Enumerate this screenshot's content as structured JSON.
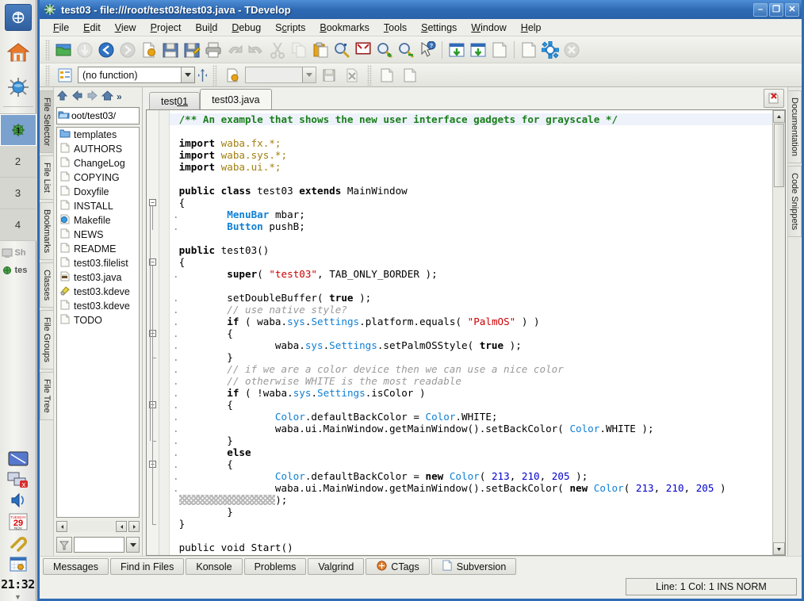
{
  "panel": {
    "launchers": [
      {
        "name": "kmenu-icon",
        "label": "K Menu"
      },
      {
        "name": "home-icon",
        "label": "Home"
      },
      {
        "name": "konqueror-icon",
        "label": "Konqueror"
      }
    ],
    "desktops": [
      "1",
      "2",
      "3",
      "4"
    ],
    "active_desktop": "1",
    "tasks": [
      {
        "label": "Sh",
        "icon": "screen-icon",
        "dim": true
      },
      {
        "label": "tes",
        "icon": "tdevelop-icon",
        "dim": false
      }
    ],
    "tray": [
      {
        "name": "display-icon"
      },
      {
        "name": "network-disconnected-icon"
      },
      {
        "name": "volume-icon"
      },
      {
        "name": "calendar-icon",
        "day": "29",
        "month": "NOV",
        "weekday": "TUESDAY"
      },
      {
        "name": "klipper-icon"
      },
      {
        "name": "korganizer-icon"
      }
    ],
    "clock": "21:32",
    "collapse": "▼"
  },
  "window": {
    "title": "test03 - file:///root/test03/test03.java - TDevelop",
    "app_icon": "tdevelop-icon",
    "buttons": {
      "minimize": "–",
      "maximize": "❐",
      "close": "✕"
    }
  },
  "menubar": {
    "items": [
      {
        "label": "File",
        "accel": "F"
      },
      {
        "label": "Edit",
        "accel": "E"
      },
      {
        "label": "View",
        "accel": "V"
      },
      {
        "label": "Project",
        "accel": "P"
      },
      {
        "label": "Build",
        "accel": "l"
      },
      {
        "label": "Debug",
        "accel": "D"
      },
      {
        "label": "Scripts",
        "accel": "c"
      },
      {
        "label": "Bookmarks",
        "accel": "B"
      },
      {
        "label": "Tools",
        "accel": "T"
      },
      {
        "label": "Settings",
        "accel": "S"
      },
      {
        "label": "Window",
        "accel": "W"
      },
      {
        "label": "Help",
        "accel": "H"
      }
    ]
  },
  "toolbar_main": {
    "buttons": [
      {
        "name": "open-file-icon",
        "enabled": true
      },
      {
        "name": "down-arrow-icon",
        "enabled": false
      },
      {
        "name": "back-arrow-icon",
        "enabled": true
      },
      {
        "name": "forward-arrow-icon",
        "enabled": false
      },
      {
        "name": "new-file-icon",
        "enabled": true
      },
      {
        "name": "save-icon",
        "enabled": true
      },
      {
        "name": "save-as-icon",
        "enabled": true
      },
      {
        "name": "print-icon",
        "enabled": true
      },
      {
        "name": "undo-icon",
        "enabled": false
      },
      {
        "name": "redo-icon",
        "enabled": false
      },
      {
        "name": "cut-icon",
        "enabled": false
      },
      {
        "name": "copy-icon",
        "enabled": false
      },
      {
        "name": "paste-icon",
        "enabled": true
      },
      {
        "name": "find-icon",
        "enabled": true
      },
      {
        "name": "find-in-files-icon",
        "enabled": true
      },
      {
        "name": "zoom-in-icon",
        "enabled": true
      },
      {
        "name": "zoom-out-icon",
        "enabled": true
      },
      {
        "name": "whats-this-icon",
        "enabled": true
      },
      {
        "name": "build-project-icon",
        "enabled": true
      },
      {
        "name": "build-file-icon",
        "enabled": true
      },
      {
        "name": "run-icon",
        "enabled": true
      },
      {
        "name": "execute-icon",
        "enabled": true
      },
      {
        "name": "configure-icon",
        "enabled": true
      },
      {
        "name": "stop-icon",
        "enabled": false
      }
    ]
  },
  "toolbar_browser": {
    "outline_icon": "code-outline-icon",
    "function_combo": {
      "value": "(no function)",
      "placeholder": "(no function)"
    },
    "resize_handle": "horizontal-resize-handle",
    "buttons_left": [
      {
        "name": "new-document-icon"
      }
    ],
    "second_combo": {
      "value": ""
    },
    "buttons_right": [
      {
        "name": "save-small-icon"
      },
      {
        "name": "revert-icon"
      },
      {
        "name": "prev-document-icon"
      },
      {
        "name": "next-document-icon"
      }
    ]
  },
  "left_tabs": {
    "items": [
      {
        "label": "File Selector",
        "selected": true
      },
      {
        "label": "File List",
        "selected": false
      },
      {
        "label": "Bookmarks",
        "selected": false
      },
      {
        "label": "Classes",
        "selected": false
      },
      {
        "label": "File Groups",
        "selected": false
      },
      {
        "label": "File Tree",
        "selected": false
      }
    ]
  },
  "right_tabs": {
    "items": [
      {
        "label": "Documentation",
        "selected": false
      },
      {
        "label": "Code Snippets",
        "selected": false
      }
    ]
  },
  "file_selector": {
    "nav": [
      {
        "name": "up-icon",
        "glyph": "⬆"
      },
      {
        "name": "back-icon",
        "glyph": "⬅"
      },
      {
        "name": "forward-icon",
        "glyph": "➡"
      },
      {
        "name": "home-icon",
        "glyph": "⌂"
      },
      {
        "name": "more-icon",
        "glyph": "»"
      }
    ],
    "path": "oot/test03/",
    "path_icon": "folder-open-icon",
    "files": [
      {
        "name": "templates",
        "icon": "folder-icon"
      },
      {
        "name": "AUTHORS",
        "icon": "file-icon"
      },
      {
        "name": "ChangeLog",
        "icon": "file-icon"
      },
      {
        "name": "COPYING",
        "icon": "file-icon"
      },
      {
        "name": "Doxyfile",
        "icon": "file-icon"
      },
      {
        "name": "INSTALL",
        "icon": "file-icon"
      },
      {
        "name": "Makefile",
        "icon": "makefile-icon"
      },
      {
        "name": "NEWS",
        "icon": "file-icon"
      },
      {
        "name": "README",
        "icon": "file-icon"
      },
      {
        "name": "test03.filelist",
        "icon": "file-icon"
      },
      {
        "name": "test03.java",
        "icon": "java-icon"
      },
      {
        "name": "test03.kdeve",
        "icon": "kdevelop-project-icon"
      },
      {
        "name": "test03.kdeve",
        "icon": "file-icon"
      },
      {
        "name": "TODO",
        "icon": "file-icon"
      }
    ],
    "filter": {
      "icon": "filter-icon",
      "value": ""
    }
  },
  "editor": {
    "tabs": [
      {
        "label": "test01",
        "accel": "01",
        "active": false
      },
      {
        "label": "test03.java",
        "active": true
      }
    ],
    "close_icon": "close-document-icon",
    "lines": [
      {
        "fold": null,
        "dot": false,
        "segs": [
          {
            "t": "/** An example that shows the new user interface gadgets for grayscale */",
            "c": "cmt"
          }
        ],
        "cur": true
      },
      {
        "fold": null,
        "dot": false,
        "segs": []
      },
      {
        "fold": null,
        "dot": false,
        "segs": [
          {
            "t": "import ",
            "c": "kw"
          },
          {
            "t": "waba.fx.*;",
            "c": "pkg"
          }
        ]
      },
      {
        "fold": null,
        "dot": false,
        "segs": [
          {
            "t": "import ",
            "c": "kw"
          },
          {
            "t": "waba.sys.*;",
            "c": "pkg"
          }
        ]
      },
      {
        "fold": null,
        "dot": false,
        "segs": [
          {
            "t": "import ",
            "c": "kw"
          },
          {
            "t": "waba.ui.*;",
            "c": "pkg"
          }
        ]
      },
      {
        "fold": null,
        "dot": false,
        "segs": []
      },
      {
        "fold": null,
        "dot": false,
        "segs": [
          {
            "t": "public class ",
            "c": "kw"
          },
          {
            "t": "test03 ",
            "c": "txt"
          },
          {
            "t": "extends ",
            "c": "kw"
          },
          {
            "t": "MainWindow",
            "c": "txt"
          }
        ]
      },
      {
        "fold": "minus",
        "dot": false,
        "segs": [
          {
            "t": "{",
            "c": "txt"
          }
        ]
      },
      {
        "fold": null,
        "dot": true,
        "segs": [
          {
            "t": "        ",
            "c": "txt"
          },
          {
            "t": "MenuBar ",
            "c": "typ"
          },
          {
            "t": "mbar;",
            "c": "txt"
          }
        ]
      },
      {
        "fold": null,
        "dot": true,
        "segs": [
          {
            "t": "        ",
            "c": "txt"
          },
          {
            "t": "Button ",
            "c": "typ"
          },
          {
            "t": "pushB;",
            "c": "txt"
          }
        ]
      },
      {
        "fold": null,
        "dot": false,
        "segs": []
      },
      {
        "fold": null,
        "dot": false,
        "segs": [
          {
            "t": "public ",
            "c": "kw"
          },
          {
            "t": "test03()",
            "c": "txt"
          }
        ]
      },
      {
        "fold": "minus",
        "dot": false,
        "segs": [
          {
            "t": "{",
            "c": "txt"
          }
        ]
      },
      {
        "fold": null,
        "dot": true,
        "segs": [
          {
            "t": "        ",
            "c": "txt"
          },
          {
            "t": "super",
            "c": "kw"
          },
          {
            "t": "( ",
            "c": "txt"
          },
          {
            "t": "\"test03\"",
            "c": "str"
          },
          {
            "t": ", TAB_ONLY_BORDER );",
            "c": "txt"
          }
        ]
      },
      {
        "fold": null,
        "dot": false,
        "segs": []
      },
      {
        "fold": null,
        "dot": true,
        "segs": [
          {
            "t": "        setDoubleBuffer( ",
            "c": "txt"
          },
          {
            "t": "true",
            "c": "kw"
          },
          {
            "t": " );",
            "c": "txt"
          }
        ]
      },
      {
        "fold": null,
        "dot": true,
        "segs": [
          {
            "t": "        // use native style?",
            "c": "cmt2"
          }
        ]
      },
      {
        "fold": null,
        "dot": true,
        "segs": [
          {
            "t": "        ",
            "c": "txt"
          },
          {
            "t": "if",
            "c": "kw"
          },
          {
            "t": " ( waba.",
            "c": "txt"
          },
          {
            "t": "sys",
            "c": "typ2"
          },
          {
            "t": ".",
            "c": "txt"
          },
          {
            "t": "Settings",
            "c": "typ2"
          },
          {
            "t": ".platform.equals( ",
            "c": "txt"
          },
          {
            "t": "\"PalmOS\"",
            "c": "str"
          },
          {
            "t": " ) )",
            "c": "txt"
          }
        ]
      },
      {
        "fold": "minus",
        "dot": true,
        "segs": [
          {
            "t": "        {",
            "c": "txt"
          }
        ]
      },
      {
        "fold": null,
        "dot": true,
        "segs": [
          {
            "t": "                waba.",
            "c": "txt"
          },
          {
            "t": "sys",
            "c": "typ2"
          },
          {
            "t": ".",
            "c": "txt"
          },
          {
            "t": "Settings",
            "c": "typ2"
          },
          {
            "t": ".setPalmOSStyle( ",
            "c": "txt"
          },
          {
            "t": "true",
            "c": "kw"
          },
          {
            "t": " );",
            "c": "txt"
          }
        ]
      },
      {
        "fold": "end",
        "dot": true,
        "segs": [
          {
            "t": "        }",
            "c": "txt"
          }
        ]
      },
      {
        "fold": null,
        "dot": true,
        "segs": [
          {
            "t": "        // if we are a color device then we can use a nice color",
            "c": "cmt2"
          }
        ]
      },
      {
        "fold": null,
        "dot": true,
        "segs": [
          {
            "t": "        // otherwise WHITE is the most readable",
            "c": "cmt2"
          }
        ]
      },
      {
        "fold": null,
        "dot": true,
        "segs": [
          {
            "t": "        ",
            "c": "txt"
          },
          {
            "t": "if",
            "c": "kw"
          },
          {
            "t": " ( !waba.",
            "c": "txt"
          },
          {
            "t": "sys",
            "c": "typ2"
          },
          {
            "t": ".",
            "c": "txt"
          },
          {
            "t": "Settings",
            "c": "typ2"
          },
          {
            "t": ".isColor )",
            "c": "txt"
          }
        ]
      },
      {
        "fold": "minus",
        "dot": true,
        "segs": [
          {
            "t": "        {",
            "c": "txt"
          }
        ]
      },
      {
        "fold": null,
        "dot": true,
        "segs": [
          {
            "t": "                ",
            "c": "txt"
          },
          {
            "t": "Color",
            "c": "typ2"
          },
          {
            "t": ".defaultBackColor = ",
            "c": "txt"
          },
          {
            "t": "Color",
            "c": "typ2"
          },
          {
            "t": ".WHITE;",
            "c": "txt"
          }
        ]
      },
      {
        "fold": null,
        "dot": true,
        "segs": [
          {
            "t": "                waba.ui.MainWindow.getMainWindow().setBackColor( ",
            "c": "txt"
          },
          {
            "t": "Color",
            "c": "typ2"
          },
          {
            "t": ".WHITE );",
            "c": "txt"
          }
        ]
      },
      {
        "fold": "end",
        "dot": true,
        "segs": [
          {
            "t": "        }",
            "c": "txt"
          }
        ]
      },
      {
        "fold": null,
        "dot": true,
        "segs": [
          {
            "t": "        ",
            "c": "txt"
          },
          {
            "t": "else",
            "c": "kw"
          }
        ]
      },
      {
        "fold": "minus",
        "dot": true,
        "segs": [
          {
            "t": "        {",
            "c": "txt"
          }
        ]
      },
      {
        "fold": null,
        "dot": true,
        "segs": [
          {
            "t": "                ",
            "c": "txt"
          },
          {
            "t": "Color",
            "c": "typ2"
          },
          {
            "t": ".defaultBackColor = ",
            "c": "txt"
          },
          {
            "t": "new ",
            "c": "kw"
          },
          {
            "t": "Color",
            "c": "typ2"
          },
          {
            "t": "( ",
            "c": "txt"
          },
          {
            "t": "213",
            "c": "num"
          },
          {
            "t": ", ",
            "c": "txt"
          },
          {
            "t": "210",
            "c": "num"
          },
          {
            "t": ", ",
            "c": "txt"
          },
          {
            "t": "205",
            "c": "num"
          },
          {
            "t": " );",
            "c": "txt"
          }
        ]
      },
      {
        "fold": null,
        "dot": true,
        "segs": [
          {
            "t": "                waba.ui.MainWindow.getMainWindow().setBackColor( ",
            "c": "txt"
          },
          {
            "t": "new ",
            "c": "kw"
          },
          {
            "t": "Color",
            "c": "typ2"
          },
          {
            "t": "( ",
            "c": "txt"
          },
          {
            "t": "213",
            "c": "num"
          },
          {
            "t": ", ",
            "c": "txt"
          },
          {
            "t": "210",
            "c": "num"
          },
          {
            "t": ", ",
            "c": "txt"
          },
          {
            "t": "205",
            "c": "num"
          },
          {
            "t": " )",
            "c": "txt"
          }
        ]
      },
      {
        "fold": null,
        "dot": false,
        "hatch": 16,
        "segs": [
          {
            "t": ");",
            "c": "txt"
          }
        ]
      },
      {
        "fold": null,
        "dot": false,
        "segs": [
          {
            "t": "        }",
            "c": "txt"
          }
        ]
      },
      {
        "fold": "end",
        "dot": false,
        "segs": [
          {
            "t": "}",
            "c": "txt"
          }
        ]
      },
      {
        "fold": null,
        "dot": false,
        "segs": []
      },
      {
        "fold": null,
        "dot": false,
        "segs": [
          {
            "t": "public void Start()",
            "c": "txt"
          }
        ]
      }
    ]
  },
  "bottom_tabs": {
    "items": [
      {
        "label": "Messages",
        "icon": null
      },
      {
        "label": "Find in Files",
        "icon": null
      },
      {
        "label": "Konsole",
        "icon": null
      },
      {
        "label": "Problems",
        "icon": null
      },
      {
        "label": "Valgrind",
        "icon": null
      },
      {
        "label": "CTags",
        "icon": "ctags-icon"
      },
      {
        "label": "Subversion",
        "icon": "subversion-icon"
      }
    ]
  },
  "statusbar": {
    "text": "Line: 1 Col: 1  INS  NORM"
  }
}
